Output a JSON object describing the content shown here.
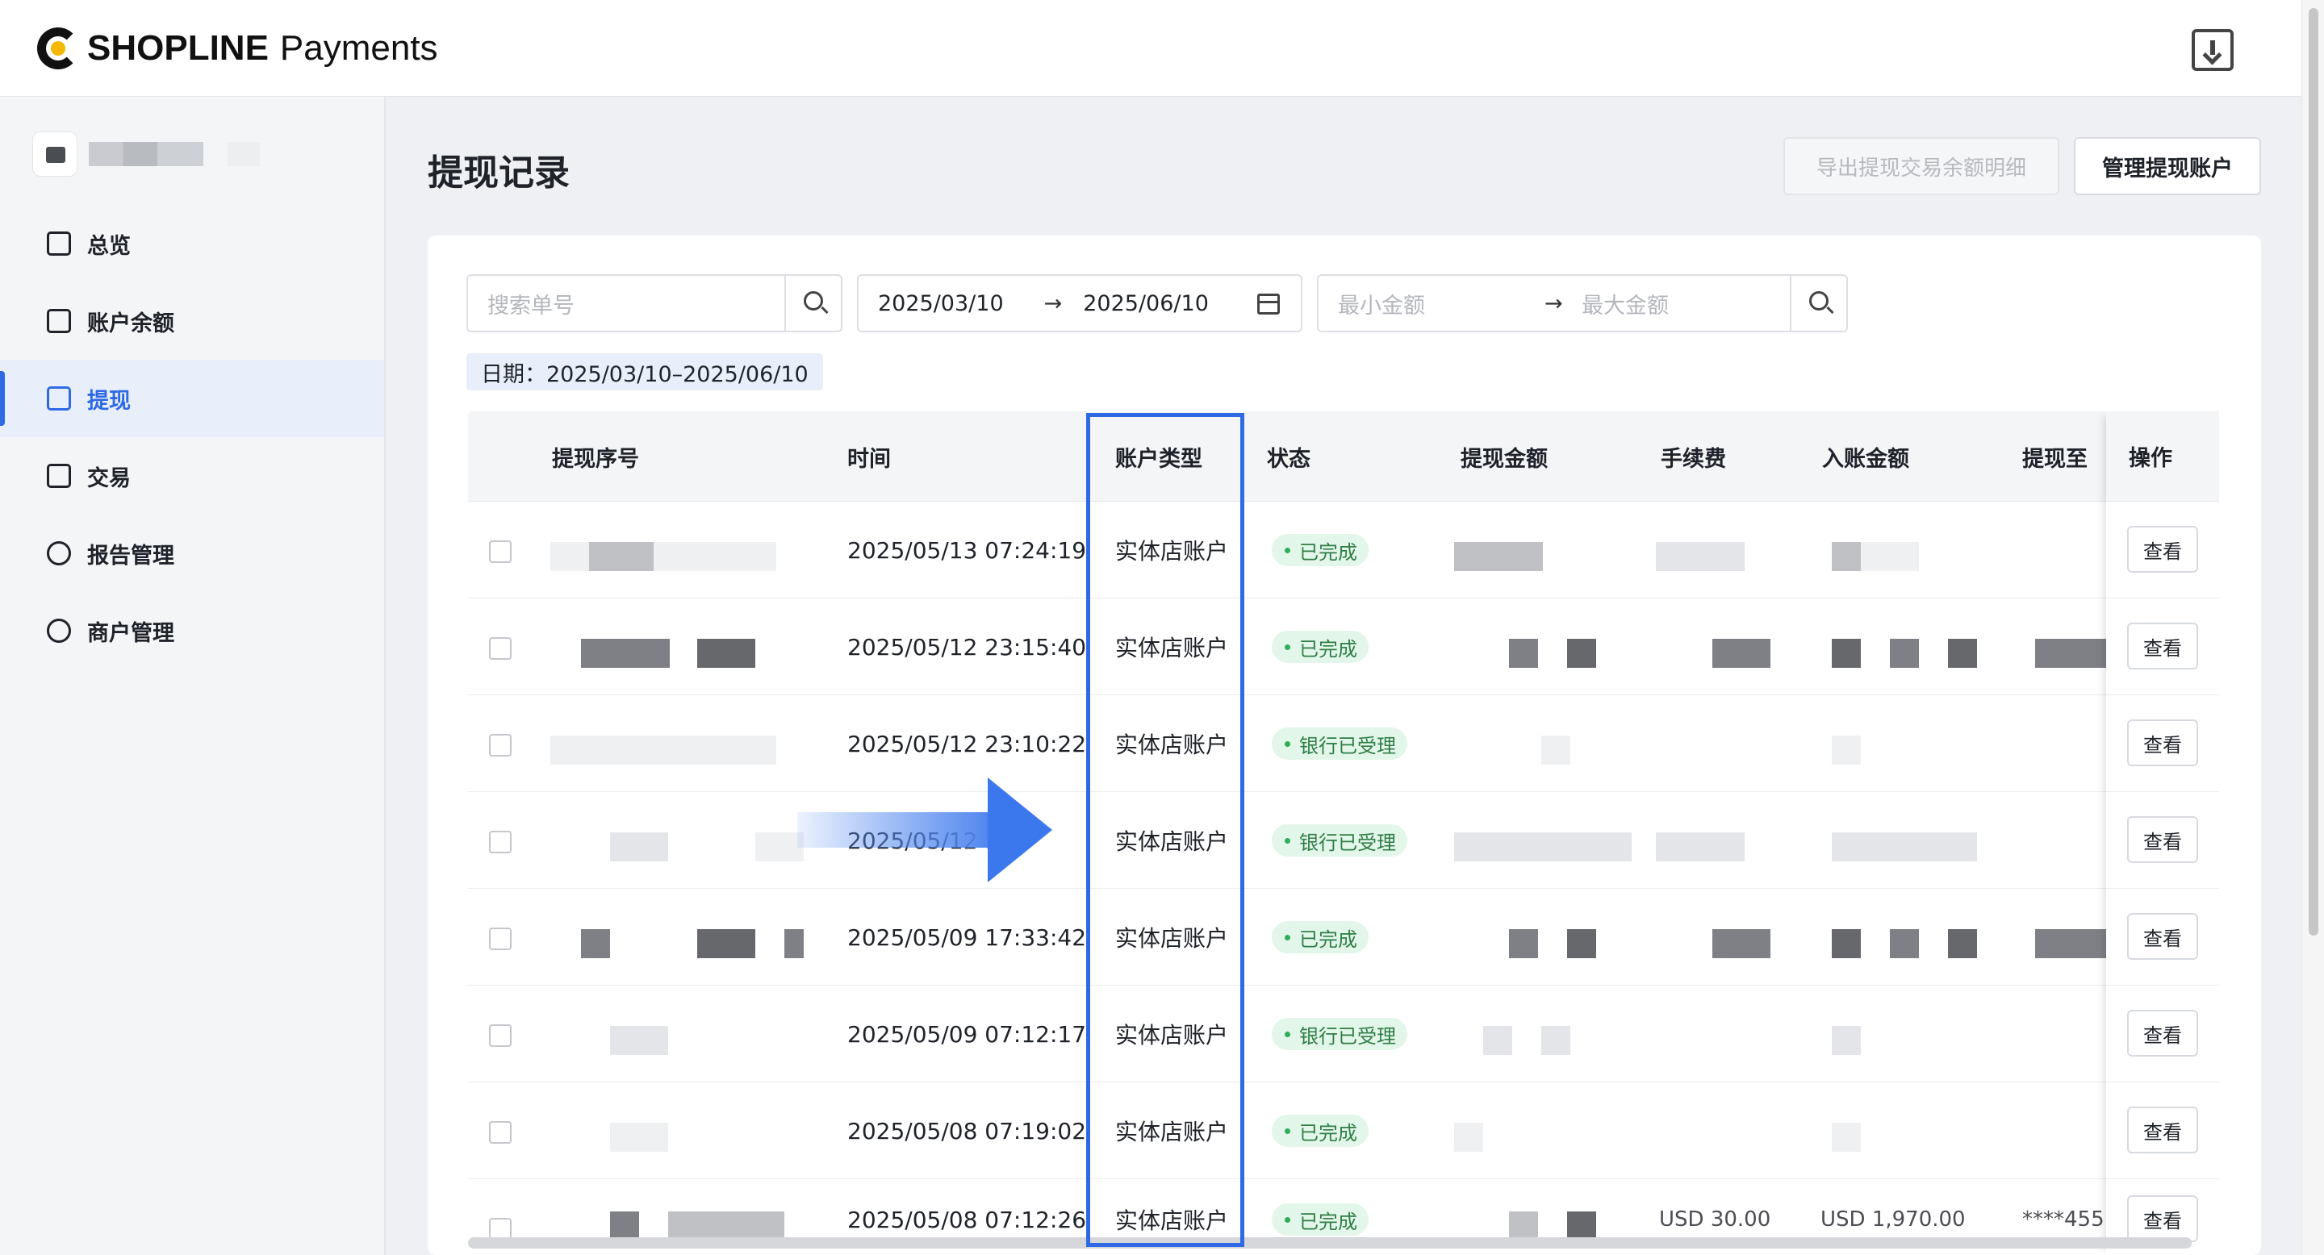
{
  "header": {
    "brand": "SHOPLINE",
    "brand_sub": "Payments"
  },
  "sidebar": {
    "items": [
      {
        "label": "总览",
        "icon": "dashboard-icon"
      },
      {
        "label": "账户余额",
        "icon": "wallet-icon"
      },
      {
        "label": "提现",
        "icon": "withdraw-icon",
        "active": true
      },
      {
        "label": "交易",
        "icon": "transaction-icon"
      },
      {
        "label": "报告管理",
        "icon": "report-icon"
      },
      {
        "label": "商户管理",
        "icon": "merchant-icon"
      }
    ]
  },
  "main": {
    "title": "提现记录",
    "export_button": "导出提现交易余额明细",
    "manage_button": "管理提现账户",
    "search_placeholder": "搜索单号",
    "date_start": "2025/03/10",
    "date_end": "2025/06/10",
    "min_amount_placeholder": "最小金额",
    "max_amount_placeholder": "最大金额",
    "range_arrow": "→",
    "date_tag": "日期：2025/03/10–2025/06/10"
  },
  "table": {
    "columns": [
      "提现序号",
      "时间",
      "账户类型",
      "状态",
      "提现金额",
      "手续费",
      "入账金额",
      "提现至",
      "操作"
    ],
    "view_label": "查看",
    "rows": [
      {
        "time": "2025/05/13 07:24:19",
        "account_type": "实体店账户",
        "status": "已完成"
      },
      {
        "time": "2025/05/12 23:15:40",
        "account_type": "实体店账户",
        "status": "已完成"
      },
      {
        "time": "2025/05/12 23:10:22",
        "account_type": "实体店账户",
        "status": "银行已受理"
      },
      {
        "time": "2025/05/12 :24",
        "account_type": "实体店账户",
        "status": "银行已受理"
      },
      {
        "time": "2025/05/09 17:33:42",
        "account_type": "实体店账户",
        "status": "已完成"
      },
      {
        "time": "2025/05/09 07:12:17",
        "account_type": "实体店账户",
        "status": "银行已受理"
      },
      {
        "time": "2025/05/08 07:19:02",
        "account_type": "实体店账户",
        "status": "已完成"
      },
      {
        "time": "2025/05/08 07:12:26",
        "account_type": "实体店账户",
        "status": "已完成",
        "fee": "USD 30.00",
        "received": "USD 1,970.00",
        "to": "****455"
      }
    ]
  },
  "colors": {
    "accent": "#2f6ae4",
    "status_green": "#2fae5a",
    "annotation_blue": "#3c78ed"
  }
}
